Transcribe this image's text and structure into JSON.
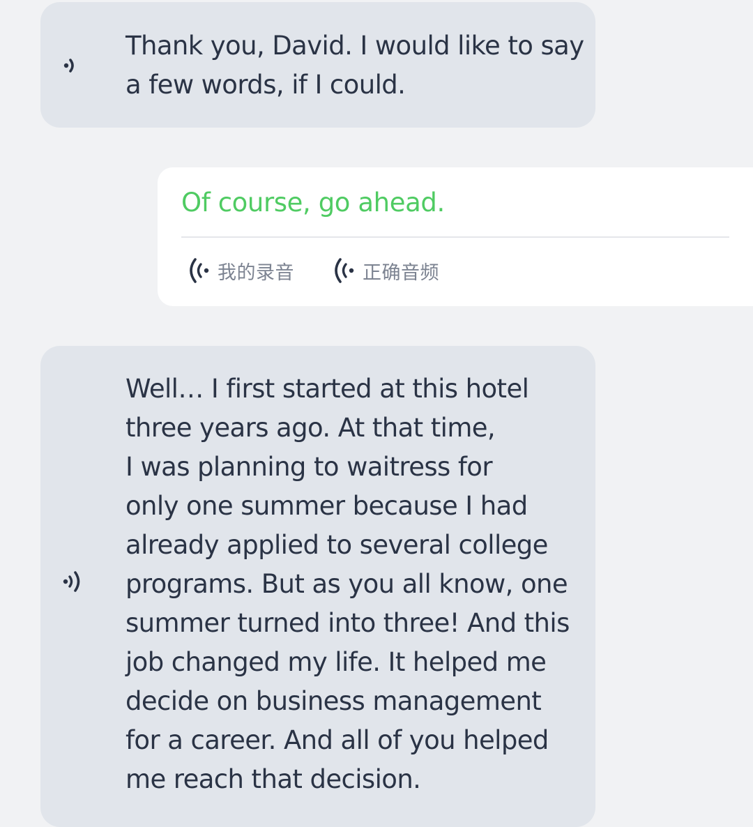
{
  "messages": [
    {
      "role": "partner",
      "icon": "speaker-icon",
      "lines": [
        "Thank you, David. I would like to say",
        "a few words, if I could."
      ]
    },
    {
      "role": "user",
      "text": "Of course, go ahead.",
      "text_color": "#4fcb62",
      "buttons": {
        "my_recording": "我的录音",
        "correct_audio": "正确音频"
      }
    },
    {
      "role": "partner",
      "icon": "speaker-icon",
      "lines": [
        "Well… I first started at this hotel",
        "three years ago. At that time,",
        "I was planning to waitress for",
        "only one summer because I had",
        "already applied to several college",
        "programs. But as you all know, one",
        "summer turned into three! And this",
        "job changed my life. It helped me",
        "decide on business management",
        "for a career. And all of you helped",
        "me reach that decision."
      ]
    }
  ],
  "colors": {
    "background": "#f1f2f4",
    "partner_bubble": "#e1e5eb",
    "user_bubble": "#ffffff",
    "text": "#2a3345",
    "correct_text": "#4fcb62",
    "secondary_text": "#7c8391"
  }
}
